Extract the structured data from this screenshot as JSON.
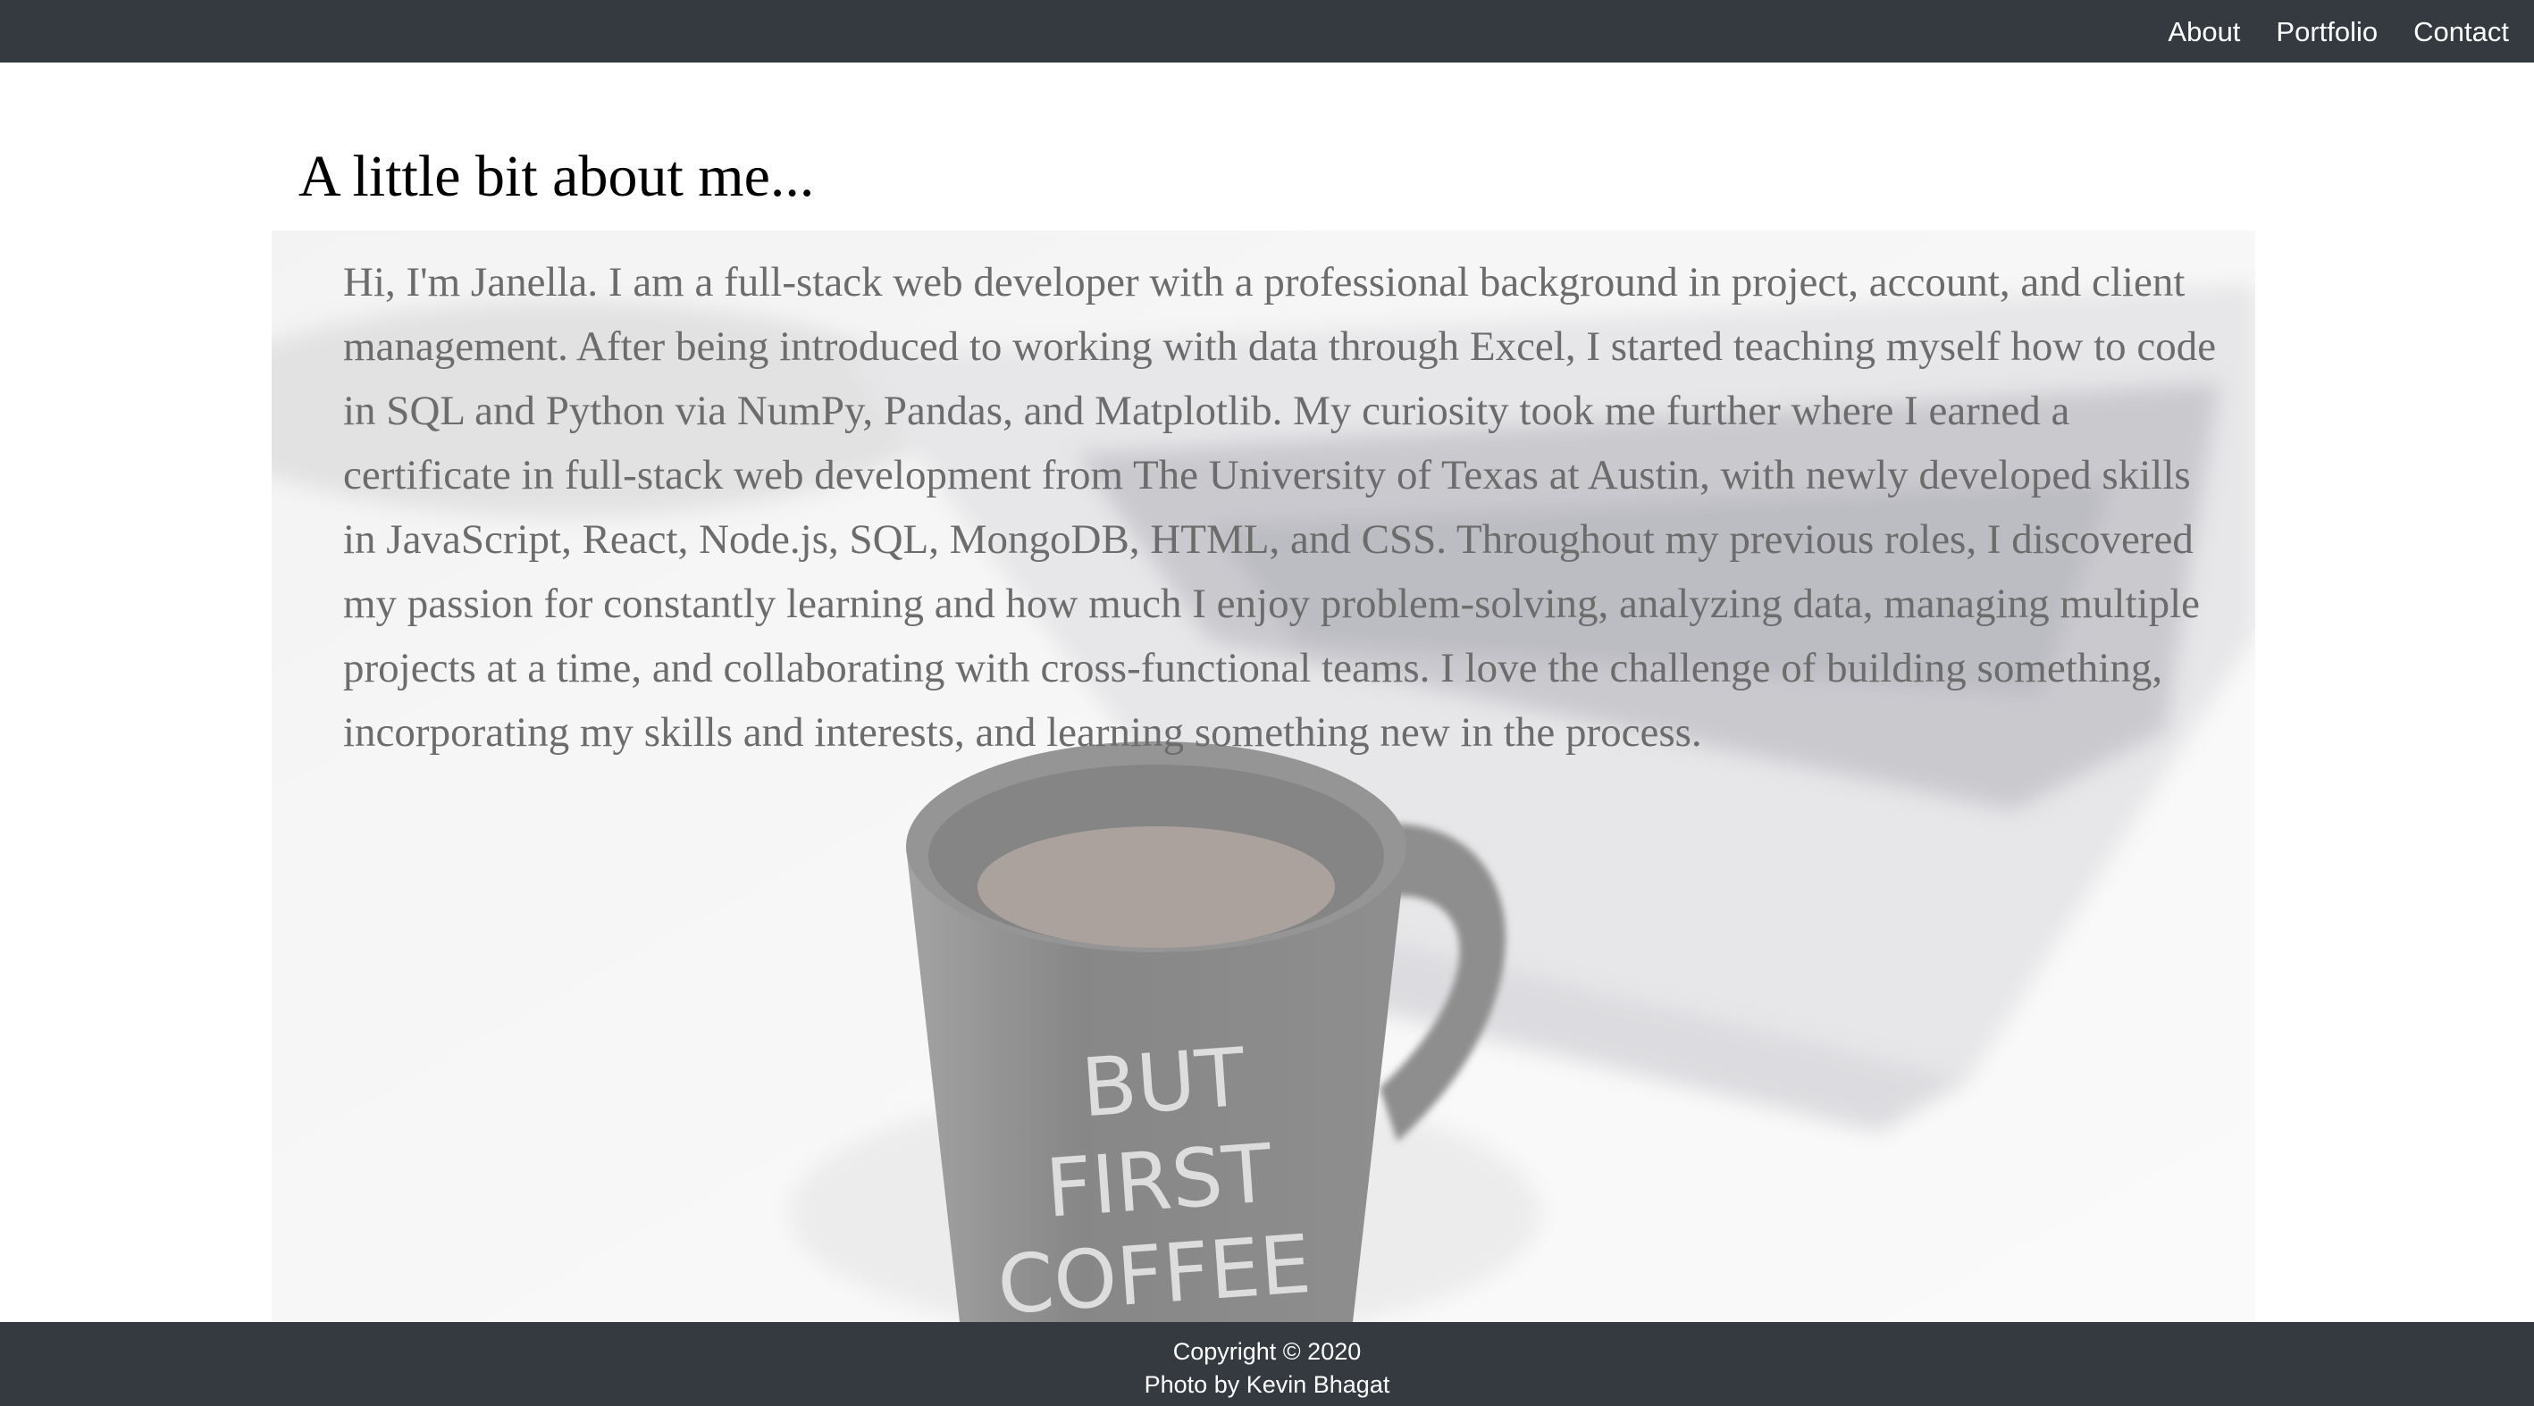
{
  "navbar": {
    "links": [
      {
        "label": "About"
      },
      {
        "label": "Portfolio"
      },
      {
        "label": "Contact"
      }
    ]
  },
  "main": {
    "title": "A little bit about me...",
    "bio": "Hi, I'm Janella. I am a full-stack web developer with a professional background in project, account, and client management. After being introduced to working with data through Excel, I started teaching myself how to code in SQL and Python via NumPy, Pandas, and Matplotlib. My curiosity took me further where I earned a certificate in full-stack web development from The University of Texas at Austin, with newly developed skills in JavaScript, React, Node.js, SQL, MongoDB, HTML, and CSS. Throughout my previous roles, I discovered my passion for constantly learning and how much I enjoy problem-solving, analyzing data, managing multiple projects at a time, and collaborating with cross-functional teams. I love the challenge of building something, incorporating my skills and interests, and learning something new in the process.",
    "background_image": {
      "mug_text": "BUT FIRST COFFEE",
      "subject": "coffee-mug-and-laptop-photo"
    }
  },
  "footer": {
    "copyright": "Copyright © 2020",
    "photo_credit": "Photo by Kevin Bhagat"
  },
  "colors": {
    "navbar_bg": "#343a40",
    "footer_bg": "#343a40",
    "nav_text": "#ffffff",
    "bio_text": "#6c6c6c"
  }
}
